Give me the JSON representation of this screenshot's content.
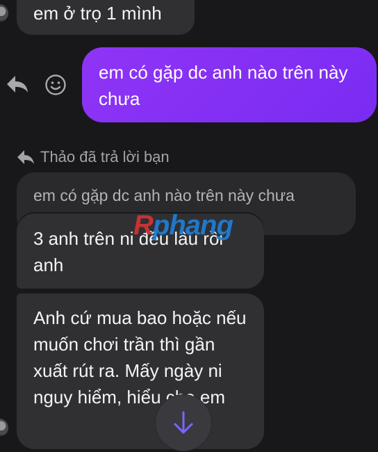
{
  "messages": {
    "top_received": "em ở trọ 1 mình",
    "sent": "em có gặp dc anh nào trên này chưa",
    "reply_header": "Thảo đã trả lời bạn",
    "quoted": "em có gặp dc anh nào trên này chưa",
    "received_1": "3 anh trên ni đều lâu rồi anh",
    "received_2": "Anh cứ mua bao hoặc nếu muốn chơi trần thì gần xuất rút ra. Mấy ngày ni nguy hiểm, hiểu cho em"
  },
  "watermark": {
    "part1": "R",
    "part2": "phang"
  },
  "icons": {
    "reply": "reply-arrow-icon",
    "react": "smiley-face-icon",
    "scroll_down": "arrow-down-icon"
  },
  "colors": {
    "background": "#18181a",
    "sent_bubble": "#8f34f6",
    "received_bubble": "#303033",
    "scroll_arrow": "#7b66ff"
  }
}
